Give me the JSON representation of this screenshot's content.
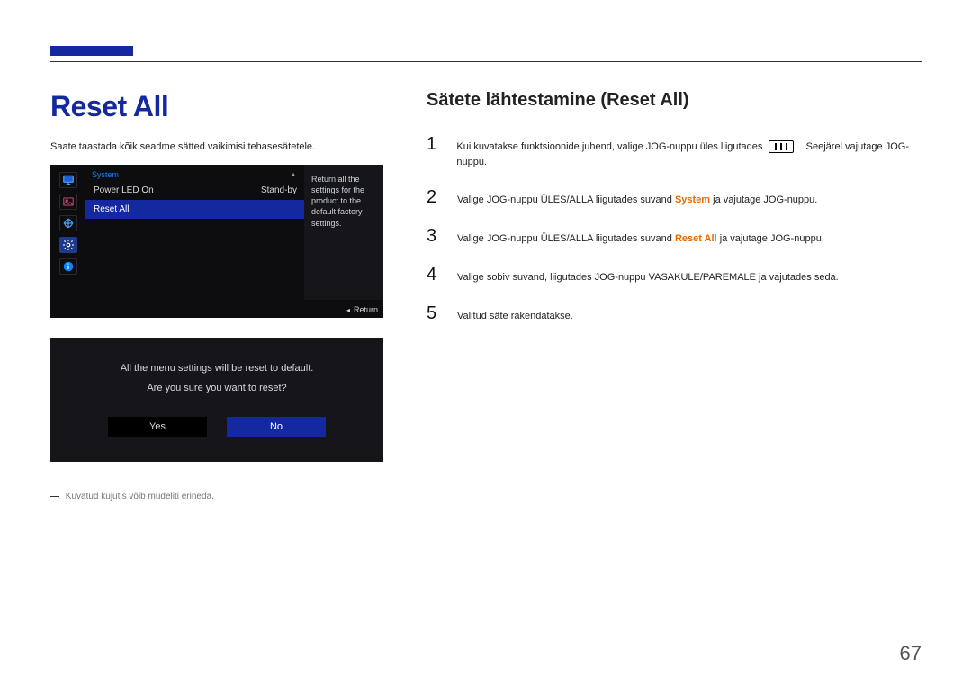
{
  "header": {
    "title": "Reset All"
  },
  "intro": "Saate taastada kõik seadme sätted vaikimisi tehasesätetele.",
  "osd": {
    "breadcrumb": "System",
    "pager_up": "▴",
    "help": "Return all the settings for the product to the default factory settings.",
    "return_label": "Return",
    "rows": [
      {
        "label": "Power LED On",
        "value": "Stand-by"
      },
      {
        "label": "Reset All",
        "value": ""
      }
    ]
  },
  "dialog": {
    "line1": "All the menu settings will be reset to default.",
    "line2": "Are you sure you want to reset?",
    "yes": "Yes",
    "no": "No"
  },
  "footnote": {
    "dash": "―",
    "text": "Kuvatud kujutis võib mudeliti erineda."
  },
  "right": {
    "subtitle": "Sätete lähtestamine (Reset All)",
    "steps": [
      {
        "n": "1",
        "pre": "Kui kuvatakse funktsioonide juhend, valige JOG-nuppu üles liigutades ",
        "post": ". Seejärel vajutage JOG-nuppu.",
        "has_icon": true
      },
      {
        "n": "2",
        "pre": "Valige JOG-nuppu ÜLES/ALLA liigutades suvand ",
        "kw": "System",
        "post": " ja vajutage JOG-nuppu."
      },
      {
        "n": "3",
        "pre": "Valige JOG-nuppu ÜLES/ALLA liigutades suvand ",
        "kw": "Reset All",
        "post": " ja vajutage JOG-nuppu."
      },
      {
        "n": "4",
        "pre": "Valige sobiv suvand, liigutades JOG-nuppu VASAKULE/PAREMALE ja vajutades seda."
      },
      {
        "n": "5",
        "pre": "Valitud säte rakendatakse."
      }
    ]
  },
  "page_number": "67"
}
